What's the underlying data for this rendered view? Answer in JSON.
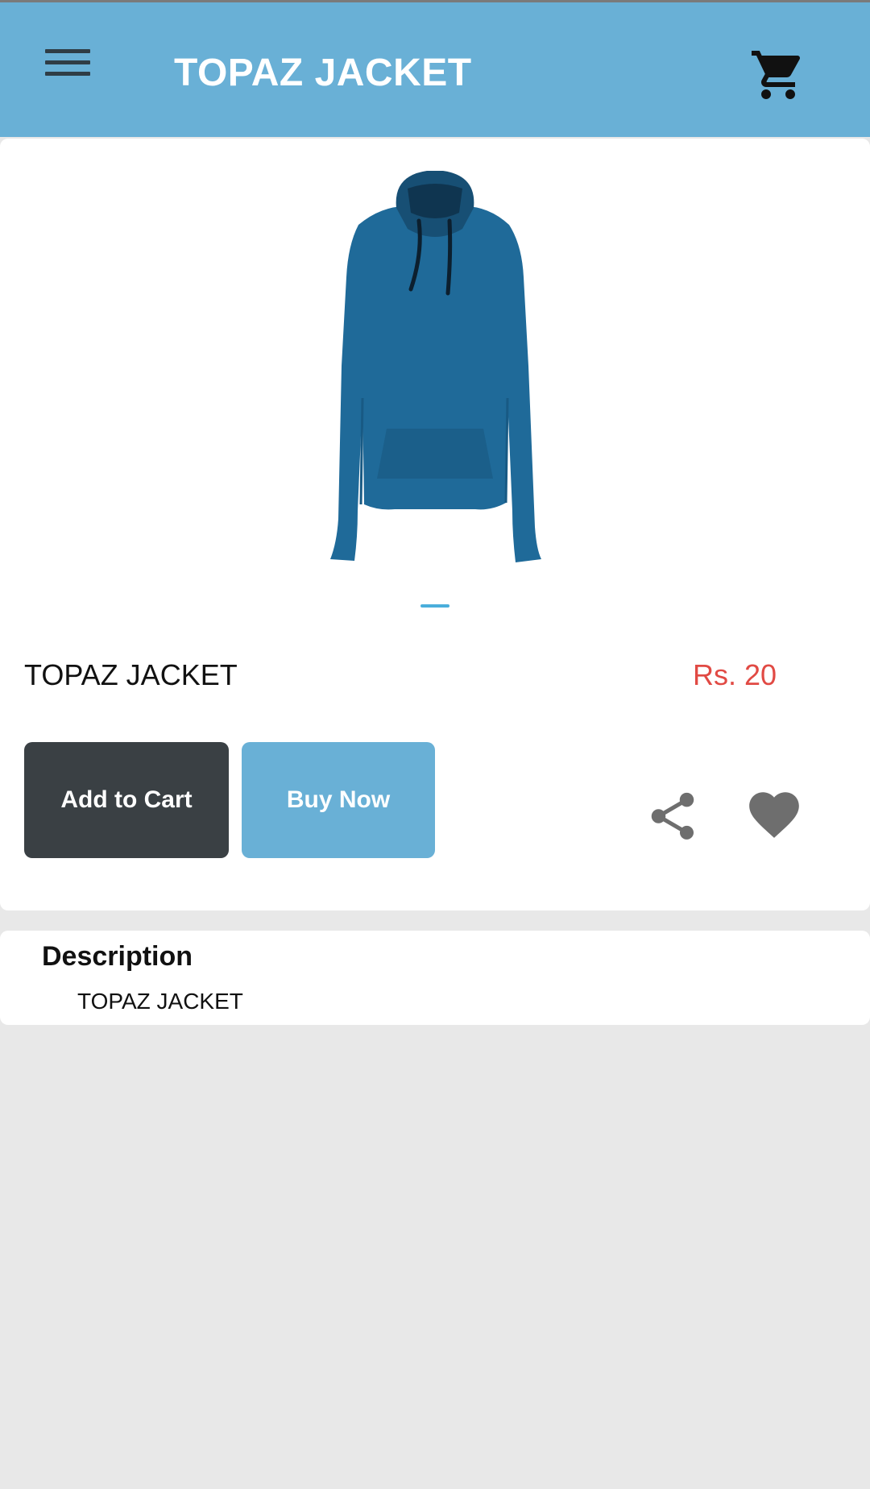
{
  "header": {
    "title": "TOPAZ JACKET",
    "menu_icon": "menu-icon",
    "cart_icon": "cart-icon"
  },
  "product": {
    "image": "blue-hooded-jacket",
    "name": "TOPAZ JACKET",
    "price": "Rs. 20",
    "image_pager": {
      "current": 1,
      "total": 1
    }
  },
  "actions": {
    "add_to_cart_label": "Add to Cart",
    "buy_now_label": "Buy Now",
    "share_icon": "share-icon",
    "favorite_icon": "heart-icon"
  },
  "description": {
    "heading": "Description",
    "text": "TOPAZ JACKET"
  },
  "colors": {
    "header_bg": "#69b0d6",
    "add_to_cart_bg": "#3a4044",
    "buy_now_bg": "#69b0d6",
    "price": "#e14a44",
    "page_bg": "#e8e8e8",
    "icon_gray": "#6e6e6e",
    "jacket_blue": "#1f6a99"
  }
}
